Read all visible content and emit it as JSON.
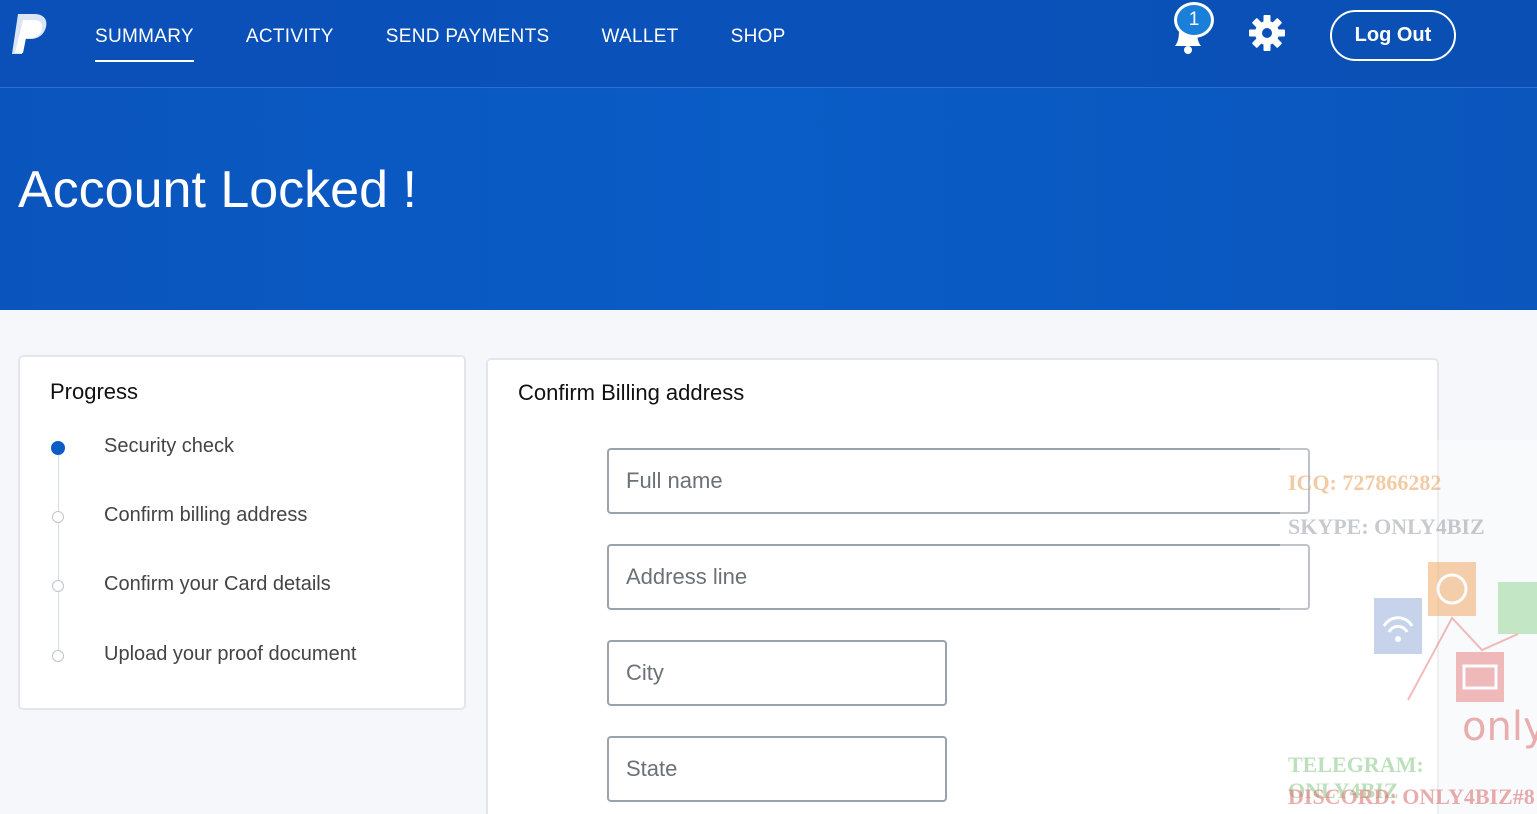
{
  "header": {
    "nav": [
      {
        "label": "SUMMARY",
        "active": true
      },
      {
        "label": "ACTIVITY",
        "active": false
      },
      {
        "label": "SEND PAYMENTS",
        "active": false
      },
      {
        "label": "WALLET",
        "active": false
      },
      {
        "label": "SHOP",
        "active": false
      }
    ],
    "notification_count": "1",
    "logout_label": "Log Out",
    "icons": [
      "paypal-logo",
      "bell-icon",
      "gear-icon"
    ]
  },
  "hero": {
    "title": "Account Locked !"
  },
  "progress": {
    "title": "Progress",
    "steps": [
      {
        "label": "Security check",
        "active": true
      },
      {
        "label": "Confirm billing address",
        "active": false
      },
      {
        "label": "Confirm your Card details",
        "active": false
      },
      {
        "label": "Upload your proof document",
        "active": false
      }
    ]
  },
  "billing": {
    "title": "Confirm Billing address",
    "fields": [
      {
        "placeholder": "Full name"
      },
      {
        "placeholder": "Address line"
      },
      {
        "placeholder": "City"
      },
      {
        "placeholder": "State"
      }
    ]
  },
  "watermark": {
    "lines": [
      "ICQ: 727866282",
      "SKYPE: ONLY4BIZ",
      "TELEGRAM: ONLY4BIZ",
      "DISCORD: ONLY4BIZ#8"
    ],
    "brand": "only"
  },
  "colors": {
    "primary": "#0a5cc6",
    "header": "#0b4fb8",
    "background": "#f5f7fa"
  }
}
